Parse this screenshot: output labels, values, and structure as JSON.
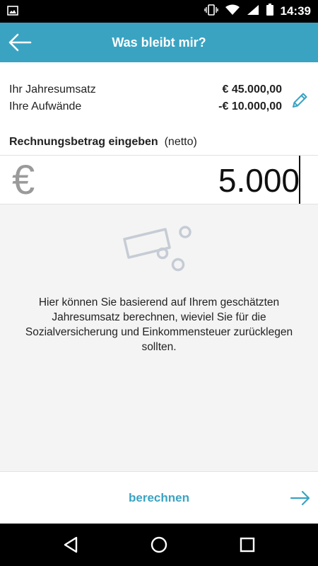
{
  "status_bar": {
    "time": "14:39",
    "icons": [
      "image-icon",
      "vibrate-icon",
      "wifi-icon",
      "signal-icon",
      "battery-icon"
    ]
  },
  "header": {
    "title": "Was bleibt mir?",
    "back_icon": "arrow-left-icon"
  },
  "summary": {
    "revenue_label": "Ihr Jahresumsatz",
    "revenue_value": "€ 45.000,00",
    "expenses_label": "Ihre Aufwände",
    "expenses_value": "-€ 10.000,00",
    "edit_icon": "pencil-icon"
  },
  "invoice": {
    "label_bold": "Rechnungsbetrag eingeben",
    "label_suffix": "(netto)",
    "currency_symbol": "€",
    "amount": "5.000"
  },
  "info": {
    "illustration_icon": "money-bill-coins-icon",
    "text": "Hier können Sie basierend auf Ihrem geschätzten Jahresumsatz berechnen, wieviel Sie für die Sozialversicherung und Einkommensteuer zurücklegen sollten."
  },
  "footer": {
    "calculate_label": "berechnen",
    "arrow_icon": "arrow-right-icon"
  },
  "nav": {
    "icons": [
      "back-triangle-icon",
      "home-circle-icon",
      "recents-square-icon"
    ]
  },
  "colors": {
    "accent": "#3aa3c2",
    "status_bar": "#000000",
    "background": "#f4f4f4"
  }
}
